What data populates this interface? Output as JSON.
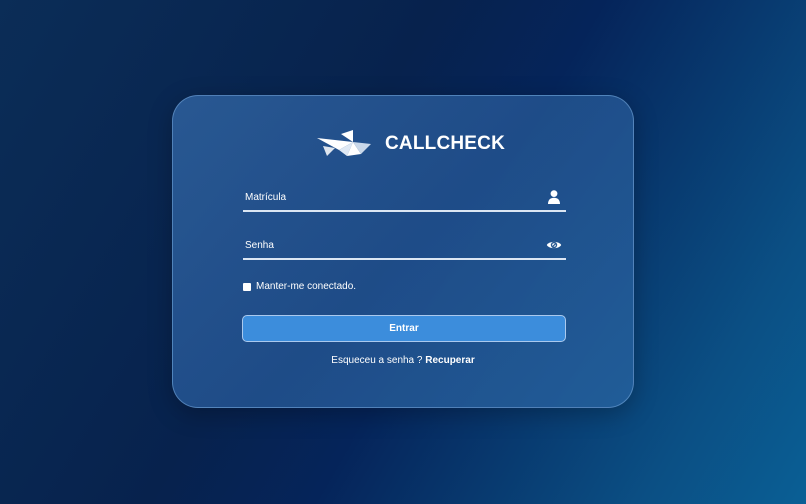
{
  "brand": {
    "name": "CALLCHECK",
    "logo_icon": "paper-plane-logo"
  },
  "form": {
    "matricula_placeholder": "Matrícula",
    "matricula_value": "",
    "matricula_icon": "user-icon",
    "senha_placeholder": "Senha",
    "senha_value": "",
    "senha_icon": "eye-icon",
    "remember_label": "Manter-me conectado.",
    "remember_checked": false,
    "submit_label": "Entrar",
    "forgot_text": "Esqueceu a senha ?",
    "forgot_link": "Recuperar"
  },
  "colors": {
    "button": "#3c8ddc",
    "card": "#2a5b94",
    "text": "#ffffff"
  }
}
